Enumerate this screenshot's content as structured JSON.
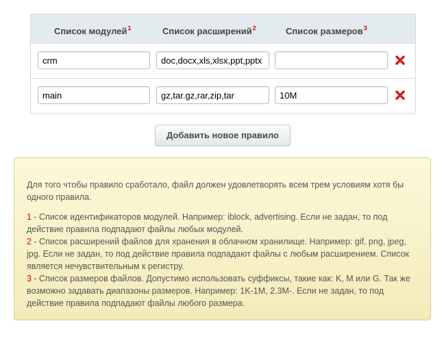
{
  "table": {
    "headers": [
      {
        "label": "Список модулей",
        "sup": "1"
      },
      {
        "label": "Список расширений",
        "sup": "2"
      },
      {
        "label": "Список размеров",
        "sup": "3"
      }
    ],
    "rows": [
      {
        "modules": "crm",
        "extensions": "doc,docx,xls,xlsx,ppt,pptx",
        "sizes": ""
      },
      {
        "modules": "main",
        "extensions": "gz,tar.gz,rar,zip,tar",
        "sizes": "10M"
      }
    ],
    "delete_icon": "close-x-icon",
    "delete_color": "#d61f1f"
  },
  "add_button_label": "Добавить новое правило",
  "note": {
    "intro": "Для того чтобы правило сработало, файл должен удовлетворять всем трем условиям хотя бы одного правила.",
    "items": [
      {
        "num": "1",
        "text": " - Список идентификаторов модулей. Например: iblock, advertising. Если не задан, то под действие правила подпадают файлы любых модулей."
      },
      {
        "num": "2",
        "text": " - Список расширений файлов для хранения в облачном хранилище. Например: gif, png, jpeg, jpg. Если не задан, то под действие правила подпадают файлы с любым расширением. Список является нечувствительным к регистру."
      },
      {
        "num": "3",
        "text": " - Список размеров файлов. Допустимо использовать суффиксы, такие как: K, M или G. Так же возможно задавать диапазоны размеров. Например: 1K-1M, 2.3M-. Если не задан, то под действие правила подпадают файлы любого размера."
      }
    ]
  }
}
